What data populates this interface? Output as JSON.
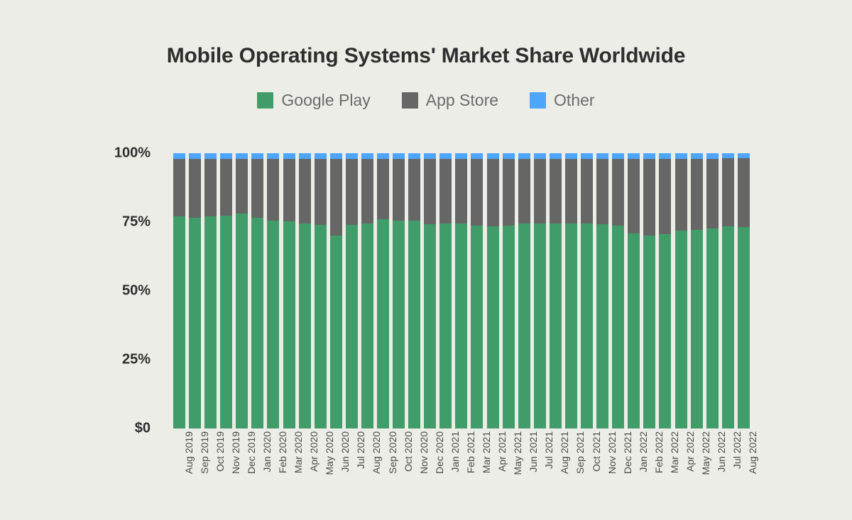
{
  "chart_data": {
    "type": "bar",
    "subtype": "stacked-percentage",
    "title": "Mobile Operating Systems' Market Share Worldwide",
    "xlabel": "",
    "ylabel": "",
    "ylim": [
      0,
      100
    ],
    "grid": false,
    "legend_position": "top-center",
    "y_ticks": [
      "$0",
      "25%",
      "50%",
      "75%",
      "100%"
    ],
    "y_tick_values": [
      0,
      25,
      50,
      75,
      100
    ],
    "categories": [
      "Aug 2019",
      "Sep 2019",
      "Oct 2019",
      "Nov 2019",
      "Dec 2019",
      "Jan 2020",
      "Feb 2020",
      "Mar 2020",
      "Apr 2020",
      "May 2020",
      "Jun 2020",
      "Jul 2020",
      "Aug 2020",
      "Sep 2020",
      "Oct 2020",
      "Nov 2020",
      "Dec 2020",
      "Jan 2021",
      "Feb 2021",
      "Mar 2021",
      "Apr 2021",
      "May 2021",
      "Jun 2021",
      "Jul 2021",
      "Aug 2021",
      "Sep 2021",
      "Oct 2021",
      "Nov 2021",
      "Dec 2021",
      "Jan 2022",
      "Feb 2022",
      "Mar 2022",
      "Apr 2022",
      "May 2022",
      "Jun 2022",
      "Jul 2022",
      "Aug 2022"
    ],
    "series": [
      {
        "name": "Google Play",
        "color": "#409d69",
        "values": [
          77.0,
          76.6,
          77.0,
          77.4,
          78.0,
          76.6,
          75.5,
          75.2,
          74.4,
          74.0,
          70.2,
          74.0,
          74.6,
          76.0,
          75.4,
          75.6,
          74.2,
          74.4,
          74.6,
          73.6,
          73.4,
          73.6,
          74.6,
          74.6,
          74.4,
          74.4,
          74.4,
          74.2,
          73.8,
          71.0,
          70.2,
          70.6,
          71.8,
          72.2,
          72.6,
          73.4,
          73.2
        ]
      },
      {
        "name": "App Store",
        "color": "#666666",
        "values": [
          20.9,
          21.3,
          20.9,
          20.5,
          19.9,
          21.3,
          22.4,
          22.7,
          23.5,
          23.9,
          27.7,
          23.9,
          23.3,
          21.9,
          22.5,
          22.3,
          23.7,
          23.5,
          23.3,
          24.3,
          24.5,
          24.3,
          23.3,
          23.3,
          23.5,
          23.5,
          23.5,
          23.7,
          24.1,
          26.9,
          27.7,
          27.3,
          26.2,
          25.8,
          25.4,
          24.7,
          24.9
        ]
      },
      {
        "name": "Other",
        "color": "#4da6fb",
        "values": [
          2.1,
          2.1,
          2.1,
          2.1,
          2.1,
          2.1,
          2.1,
          2.1,
          2.1,
          2.1,
          2.1,
          2.1,
          2.1,
          2.1,
          2.1,
          2.1,
          2.1,
          2.1,
          2.1,
          2.1,
          2.1,
          2.1,
          2.1,
          2.1,
          2.1,
          2.1,
          2.1,
          2.1,
          2.1,
          2.1,
          2.1,
          2.1,
          2.0,
          2.0,
          2.0,
          1.9,
          1.9
        ]
      }
    ]
  },
  "colors": {
    "background": "#edede7",
    "google_play": "#409d69",
    "app_store": "#666666",
    "other": "#4da6fb",
    "title_text": "#2e2e2e",
    "legend_text": "#6b6b6b",
    "axis_text": "#4a4a4a"
  }
}
